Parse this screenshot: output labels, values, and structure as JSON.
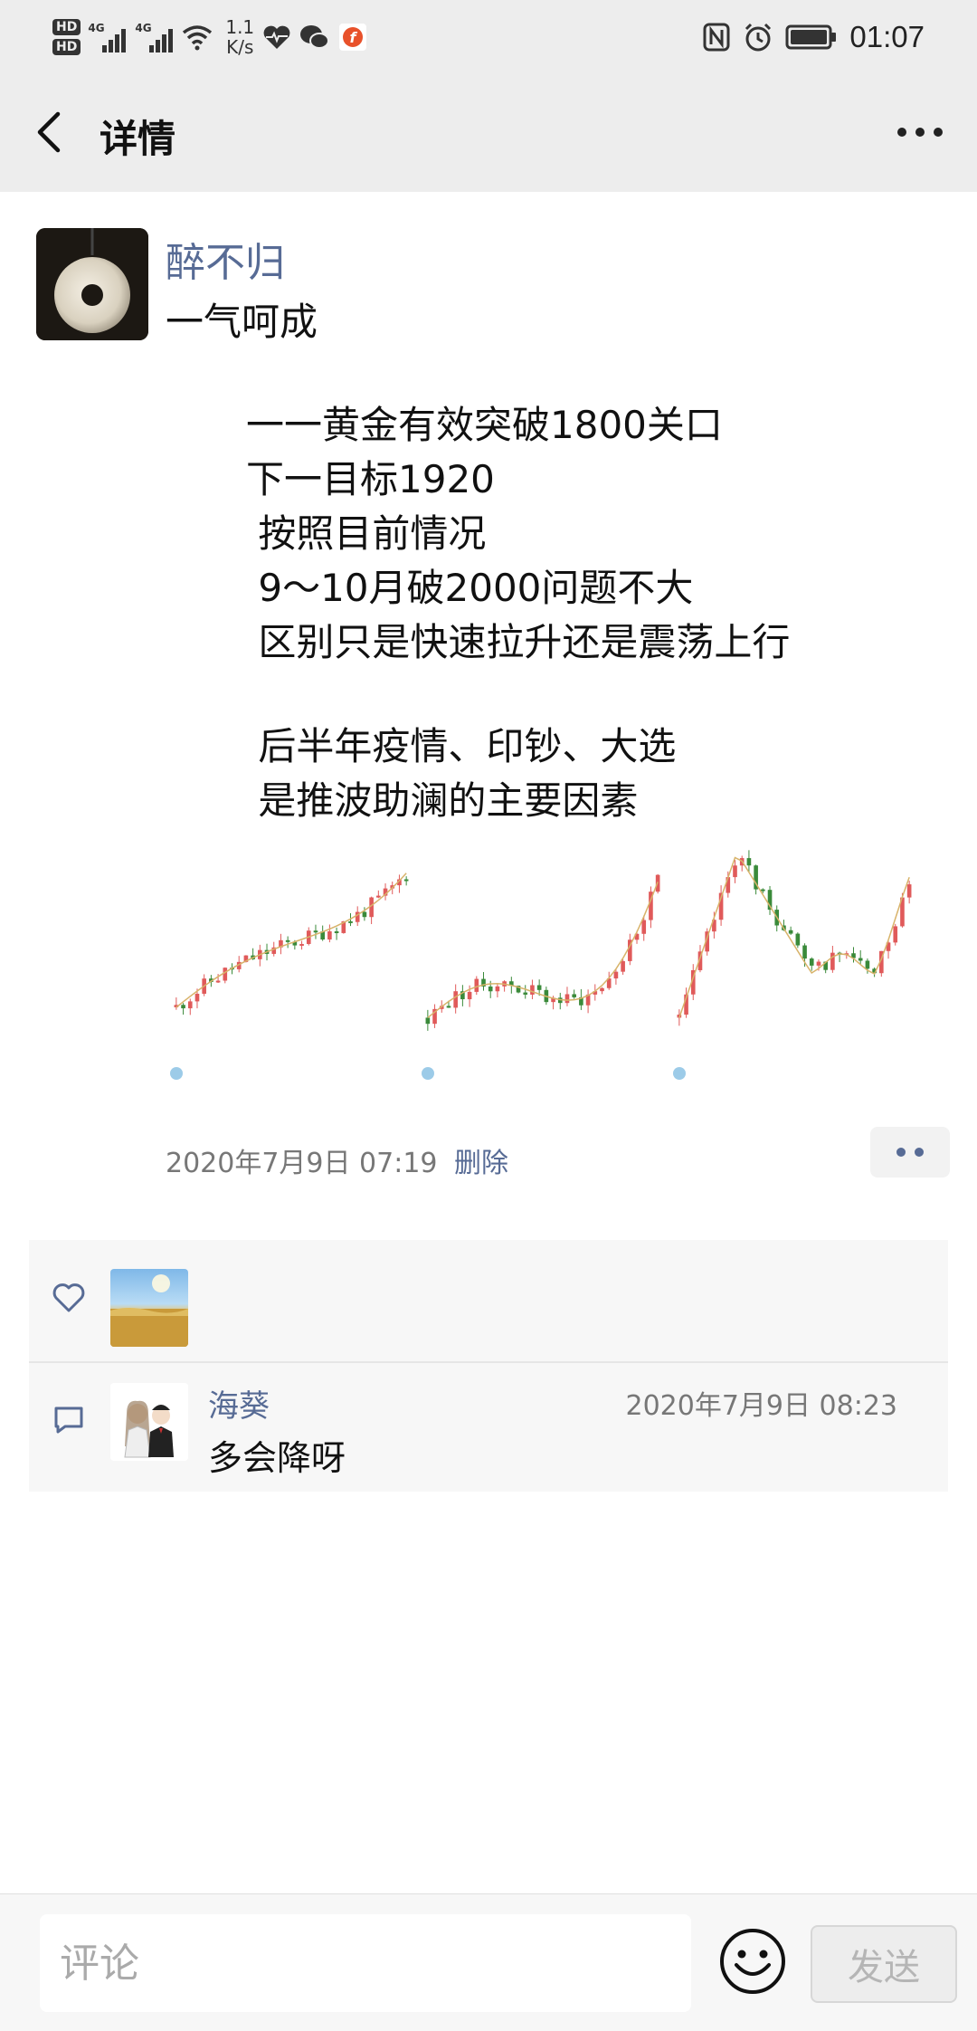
{
  "status_bar": {
    "hd1": "HD",
    "hd2": "HD",
    "signal1_label": "4G",
    "signal2_label": "4G",
    "net_speed_value": "1.1",
    "net_speed_unit": "K/s",
    "time": "01:07",
    "icons": [
      "wifi-icon",
      "health-icon",
      "wechat-icon",
      "app-f-icon",
      "nfc-icon",
      "alarm-icon",
      "battery-icon"
    ]
  },
  "header": {
    "title": "详情"
  },
  "post": {
    "username": "醉不归",
    "lines": [
      "一气呵成",
      "一一黄金有效突破1800关口",
      "下一目标1920",
      " 按照目前情况",
      " 9～10月破2000问题不大",
      " 区别只是快速拉升还是震荡上行",
      " 后半年疫情、印钞、大选",
      " 是推波助澜的主要因素"
    ],
    "timestamp": "2020年7月9日 07:19",
    "delete_label": "删除",
    "image_count": 3
  },
  "likes": {
    "count": 1
  },
  "comments": [
    {
      "name": "海葵",
      "time": "2020年7月9日 08:23",
      "text": "多会降呀"
    }
  ],
  "bottom_bar": {
    "input_placeholder": "评论",
    "send_label": "发送"
  },
  "colors": {
    "link": "#576b95",
    "header_bg": "#ededed",
    "candle_up": "#e05a5a",
    "candle_down": "#3a8a3a"
  }
}
